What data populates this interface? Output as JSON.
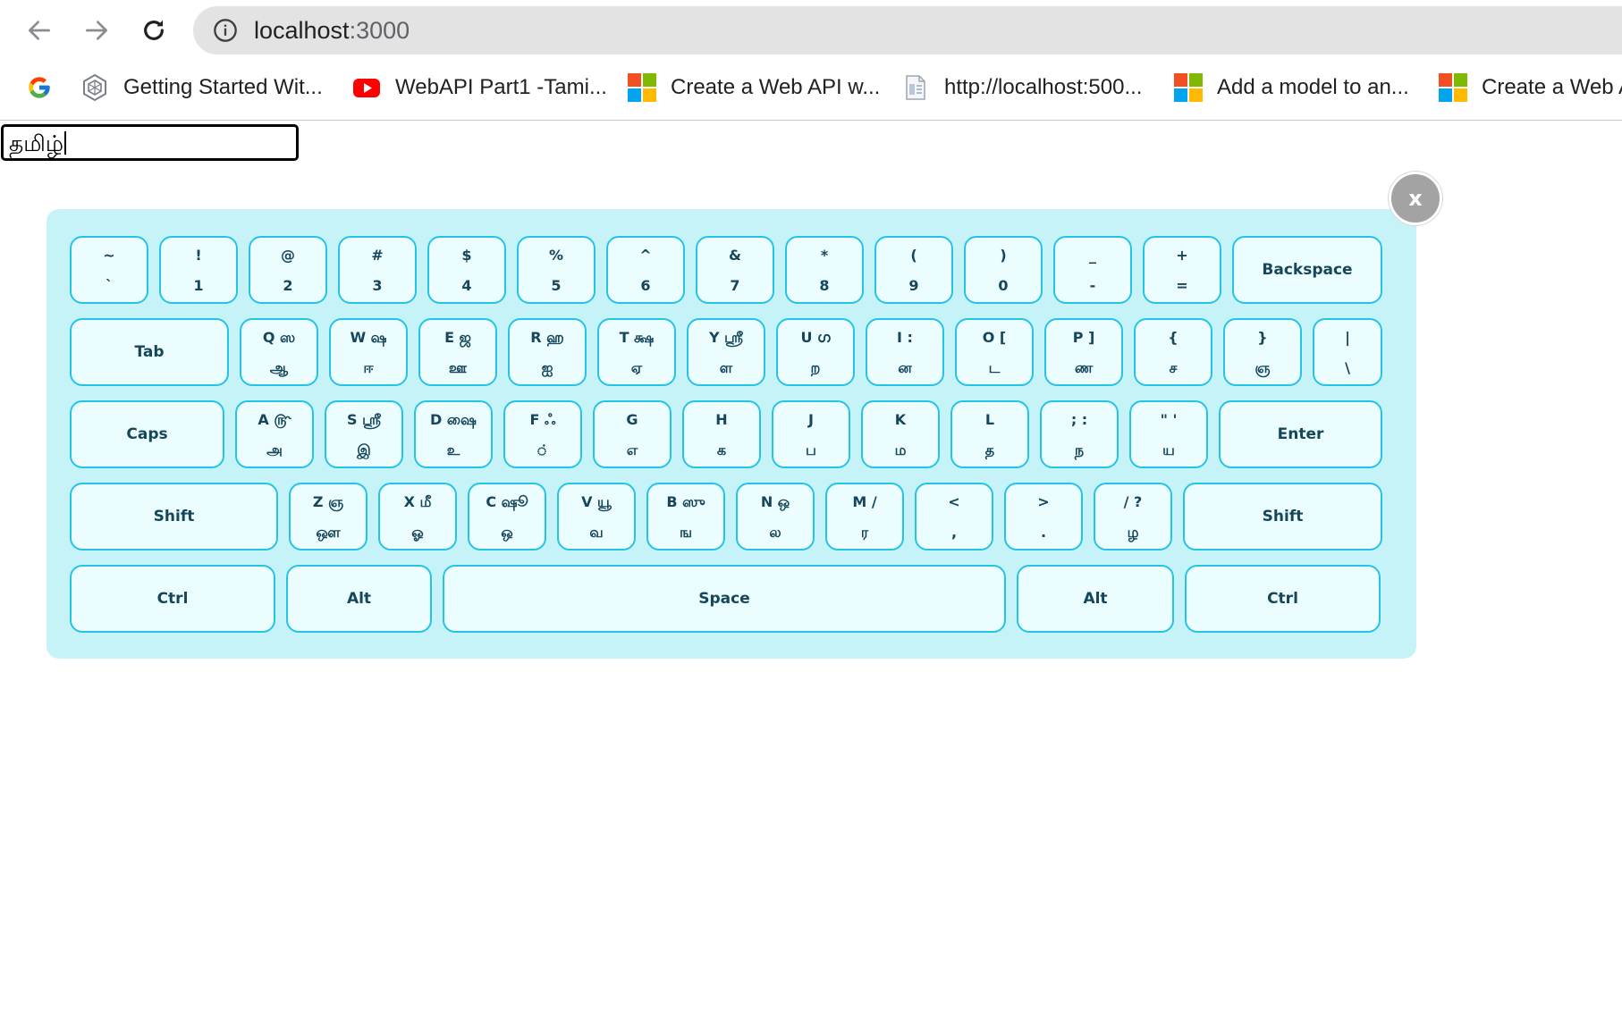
{
  "browser": {
    "url_host": "localhost",
    "url_port": ":3000",
    "bookmarks": [
      {
        "label": "Getting Started Wit...",
        "icon": "hexagon-logo-icon"
      },
      {
        "label": "WebAPI Part1 -Tami...",
        "icon": "youtube-icon"
      },
      {
        "label": "Create a Web API w...",
        "icon": "microsoft-icon"
      },
      {
        "label": "http://localhost:500...",
        "icon": "document-icon"
      },
      {
        "label": "Add a model to an...",
        "icon": "microsoft-icon"
      },
      {
        "label": "Create a Web A",
        "icon": "microsoft-icon"
      }
    ]
  },
  "colors": {
    "keyboard_bg": "#c6f3f8",
    "key_bg": "#ebfdff",
    "key_border": "#24c4e6",
    "key_text": "#16465a",
    "close_bg": "#a3a3a3"
  },
  "input": {
    "value": "தமிழ்"
  },
  "keyboard": {
    "close_label": "x",
    "rows": [
      [
        {
          "top": "~",
          "bottom": "`"
        },
        {
          "top": "!",
          "bottom": "1"
        },
        {
          "top": "@",
          "bottom": "2"
        },
        {
          "top": "#",
          "bottom": "3"
        },
        {
          "top": "$",
          "bottom": "4"
        },
        {
          "top": "%",
          "bottom": "5"
        },
        {
          "top": "^",
          "bottom": "6"
        },
        {
          "top": "&",
          "bottom": "7"
        },
        {
          "top": "*",
          "bottom": "8"
        },
        {
          "top": "(",
          "bottom": "9"
        },
        {
          "top": ")",
          "bottom": "0"
        },
        {
          "top": "_",
          "bottom": "-"
        },
        {
          "top": "+",
          "bottom": "="
        },
        {
          "label": "Backspace"
        }
      ],
      [
        {
          "label": "Tab"
        },
        {
          "top": "Q ஸ",
          "bottom": "ஆ"
        },
        {
          "top": "W ஷ",
          "bottom": "ஈ"
        },
        {
          "top": "E ஜ",
          "bottom": "ஊ"
        },
        {
          "top": "R ஹ",
          "bottom": "ஐ"
        },
        {
          "top": "T க்ஷ",
          "bottom": "ஏ"
        },
        {
          "top": "Y ஸ்ரீ",
          "bottom": "ள"
        },
        {
          "top": "U ഗ",
          "bottom": "ற"
        },
        {
          "top": "I :",
          "bottom": "ன"
        },
        {
          "top": "O [",
          "bottom": "ட"
        },
        {
          "top": "P ]",
          "bottom": "ண"
        },
        {
          "top": "{",
          "bottom": "ச"
        },
        {
          "top": "}",
          "bottom": "ஞ"
        },
        {
          "top": "|",
          "bottom": "\\"
        }
      ],
      [
        {
          "label": "Caps"
        },
        {
          "top": "A ௹",
          "bottom": "அ"
        },
        {
          "top": "S ஶ்ரீ",
          "bottom": "இ"
        },
        {
          "top": "D ஷை",
          "bottom": "உ"
        },
        {
          "top": "F ஃ",
          "bottom": "்"
        },
        {
          "top": "G",
          "bottom": "எ"
        },
        {
          "top": "H",
          "bottom": "க"
        },
        {
          "top": "J",
          "bottom": "ப"
        },
        {
          "top": "K",
          "bottom": "ம"
        },
        {
          "top": "L",
          "bottom": "த"
        },
        {
          "top": "; :",
          "bottom": "ந"
        },
        {
          "top": "\" '",
          "bottom": "ய"
        },
        {
          "label": "Enter"
        }
      ],
      [
        {
          "label": "Shift"
        },
        {
          "top": "Z ஞ",
          "bottom": "ஔ"
        },
        {
          "top": "X மீ",
          "bottom": "ஓ"
        },
        {
          "top": "C ஷூ",
          "bottom": "ஒ"
        },
        {
          "top": "V யூ",
          "bottom": "வ"
        },
        {
          "top": "B ஸு",
          "bottom": "ங"
        },
        {
          "top": "N ஒ",
          "bottom": "ல"
        },
        {
          "top": "M /",
          "bottom": "ர"
        },
        {
          "top": "<",
          "bottom": ","
        },
        {
          "top": ">",
          "bottom": "."
        },
        {
          "top": "/ ?",
          "bottom": "ழ"
        },
        {
          "label": "Shift"
        }
      ],
      [
        {
          "label": "Ctrl"
        },
        {
          "label": "Alt"
        },
        {
          "label": "Space"
        },
        {
          "label": "Alt"
        },
        {
          "label": "Ctrl"
        }
      ]
    ]
  }
}
